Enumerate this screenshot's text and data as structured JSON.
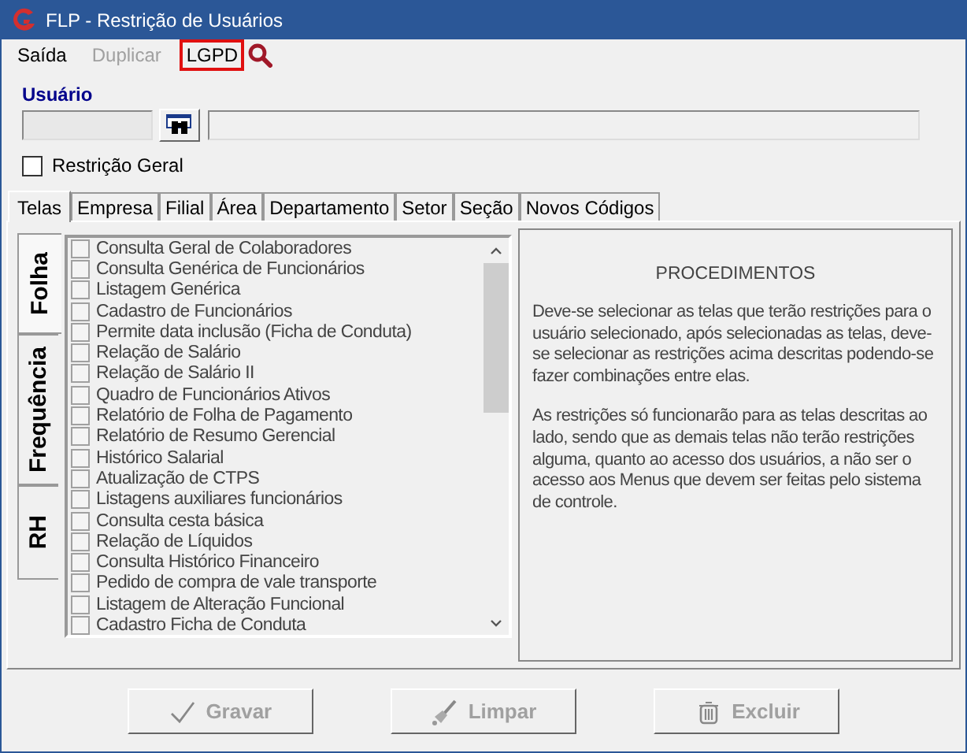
{
  "window": {
    "title": "FLP - Restrição de Usuários"
  },
  "menu": [
    {
      "label": "Saída",
      "disabled": false,
      "highlighted": false
    },
    {
      "label": "Duplicar",
      "disabled": true,
      "highlighted": false
    },
    {
      "label": "LGPD",
      "disabled": false,
      "highlighted": true
    }
  ],
  "user": {
    "label": "Usuário"
  },
  "general_restriction": {
    "label": "Restrição Geral",
    "checked": false
  },
  "tabs": [
    {
      "label": "Telas",
      "selected": true
    },
    {
      "label": "Empresa",
      "selected": false
    },
    {
      "label": "Filial",
      "selected": false
    },
    {
      "label": "Área",
      "selected": false
    },
    {
      "label": "Departamento",
      "selected": false
    },
    {
      "label": "Setor",
      "selected": false
    },
    {
      "label": "Seção",
      "selected": false
    },
    {
      "label": "Novos Códigos",
      "selected": false
    }
  ],
  "side_tabs": [
    {
      "label": "Folha",
      "selected": true
    },
    {
      "label": "Frequência",
      "selected": false
    },
    {
      "label": "RH",
      "selected": false
    }
  ],
  "screens": [
    {
      "label": "Consulta Geral de Colaboradores",
      "checked": false
    },
    {
      "label": "Consulta Genérica de Funcionários",
      "checked": false
    },
    {
      "label": "Listagem Genérica",
      "checked": false
    },
    {
      "label": "Cadastro de Funcionários",
      "checked": false
    },
    {
      "label": "Permite data inclusão (Ficha de Conduta)",
      "checked": false
    },
    {
      "label": "Relação de Salário",
      "checked": false
    },
    {
      "label": "Relação de Salário II",
      "checked": false
    },
    {
      "label": "Quadro de Funcionários Ativos",
      "checked": false
    },
    {
      "label": "Relatório de Folha de Pagamento",
      "checked": false
    },
    {
      "label": "Relatório de Resumo Gerencial",
      "checked": false
    },
    {
      "label": "Histórico Salarial",
      "checked": false
    },
    {
      "label": "Atualização de CTPS",
      "checked": false
    },
    {
      "label": "Listagens auxiliares funcionários",
      "checked": false
    },
    {
      "label": "Consulta cesta básica",
      "checked": false
    },
    {
      "label": "Relação de Líquidos",
      "checked": false
    },
    {
      "label": "Consulta Histórico Financeiro",
      "checked": false
    },
    {
      "label": "Pedido de compra de vale transporte",
      "checked": false
    },
    {
      "label": "Listagem de Alteração Funcional",
      "checked": false
    },
    {
      "label": "Cadastro Ficha de Conduta",
      "checked": false
    }
  ],
  "procedures": {
    "title": "PROCEDIMENTOS",
    "paragraphs": [
      "Deve-se selecionar as telas que terão restrições para o usuário selecionado, após selecionadas as telas, deve-se selecionar as restrições acima descritas podendo-se fazer combinações entre elas.",
      "As restrições só funcionarão para as telas descritas ao lado, sendo que as demais telas não terão restrições alguma, quanto ao acesso dos usuários, a não ser o acesso aos Menus que devem ser feitas pelo sistema de controle."
    ]
  },
  "buttons": [
    {
      "kind": "save",
      "label": "Gravar",
      "disabled": true
    },
    {
      "kind": "clear",
      "label": "Limpar",
      "disabled": true
    },
    {
      "kind": "delete",
      "label": "Excluir",
      "disabled": true
    }
  ]
}
